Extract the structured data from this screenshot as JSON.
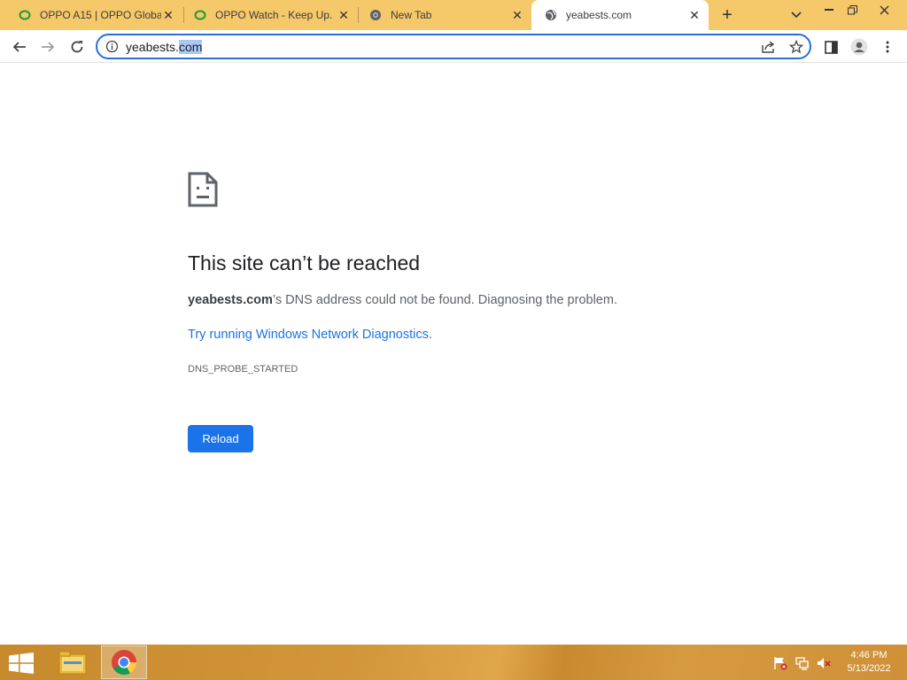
{
  "tabs": [
    {
      "title": "OPPO A15 | OPPO Global",
      "favicon": "oppo-ring-icon",
      "active": false
    },
    {
      "title": "OPPO Watch - Keep Up.",
      "favicon": "oppo-ring-icon",
      "active": false
    },
    {
      "title": "New Tab",
      "favicon": "chrome-icon",
      "active": false
    },
    {
      "title": "yeabests.com",
      "favicon": "globe-icon",
      "active": true
    }
  ],
  "omnibox": {
    "url_host": "yeabests.",
    "url_selected": "com"
  },
  "error": {
    "title": "This site can’t be reached",
    "host_bold": "yeabests.com",
    "desc_rest": "’s DNS address could not be found. Diagnosing the problem.",
    "link": "Try running Windows Network Diagnostics",
    "link_period": ".",
    "code": "DNS_PROBE_STARTED",
    "reload_label": "Reload"
  },
  "taskbar": {
    "time": "4:46 PM",
    "date": "5/13/2022"
  },
  "colors": {
    "tabstrip": "#f5c86a",
    "accent": "#1a73e8",
    "oppo_green": "#1f9e2c"
  }
}
